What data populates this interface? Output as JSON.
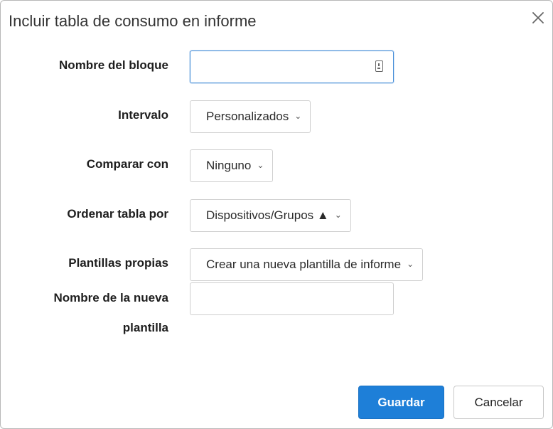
{
  "dialog": {
    "title": "Incluir tabla de consumo en informe"
  },
  "form": {
    "block_name": {
      "label": "Nombre del bloque",
      "value": "",
      "placeholder": ""
    },
    "interval": {
      "label": "Intervalo",
      "value": "Personalizados"
    },
    "compare": {
      "label": "Comparar con",
      "value": "Ninguno"
    },
    "sort": {
      "label": "Ordenar tabla por",
      "value": "Dispositivos/Grupos ▲"
    },
    "templates": {
      "label": "Plantillas propias",
      "value": "Crear una nueva plantilla de informe"
    },
    "new_template_name": {
      "label_line1": "Nombre de la nueva",
      "label_line2": "plantilla",
      "value": "",
      "placeholder": ""
    }
  },
  "buttons": {
    "save": "Guardar",
    "cancel": "Cancelar"
  },
  "colors": {
    "primary": "#1e7fd8",
    "focus": "#4a90d9"
  },
  "icons": {
    "close": "close-icon",
    "field": "contact-card-icon",
    "dropdown": "chevron-down-icon"
  }
}
